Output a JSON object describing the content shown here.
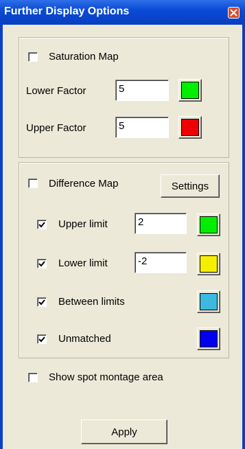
{
  "window": {
    "title": "Further Display Options"
  },
  "saturation": {
    "checkbox_label": "Saturation Map",
    "checked": false,
    "lower_label": "Lower Factor",
    "lower_value": "5",
    "lower_color": "#00ee00",
    "upper_label": "Upper Factor",
    "upper_value": "5",
    "upper_color": "#ee0000"
  },
  "difference": {
    "checkbox_label": "Difference Map",
    "checked": false,
    "settings_label": "Settings",
    "rows": [
      {
        "label": "Upper limit",
        "checked": true,
        "value": "2",
        "color": "#00ee00"
      },
      {
        "label": "Lower limit",
        "checked": true,
        "value": "-2",
        "color": "#f5f000"
      },
      {
        "label": "Between limits",
        "checked": true,
        "color": "#3db9e0"
      },
      {
        "label": "Unmatched",
        "checked": true,
        "color": "#0000f0"
      }
    ]
  },
  "montage": {
    "label": "Show spot montage area",
    "checked": false
  },
  "apply_label": "Apply"
}
